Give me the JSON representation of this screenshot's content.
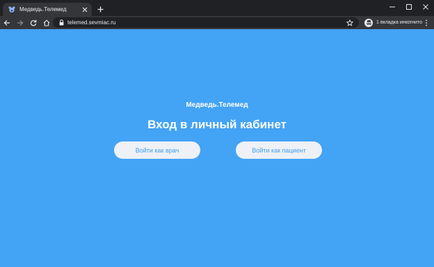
{
  "browser": {
    "tab": {
      "title": "Медведь.Телемед",
      "favicon": "bear-favicon-icon"
    },
    "new_tab_icon": "plus-icon",
    "window_controls": [
      "minimize-icon",
      "maximize-icon",
      "close-icon"
    ],
    "address_bar": {
      "url": "telemed.sevmiac.ru"
    },
    "incognito_label": "1 вкладка инкогнито"
  },
  "page": {
    "brand": "Медведь.Телемед",
    "heading": "Вход в личный кабинет",
    "buttons": {
      "doctor": "Войти как врач",
      "patient": "Войти как пациент"
    }
  },
  "colors": {
    "page_background": "#43a3f5",
    "button_background": "#eef1f6",
    "button_text": "#3f9df0",
    "tabstrip": "#202124",
    "toolbar": "#35363a"
  }
}
